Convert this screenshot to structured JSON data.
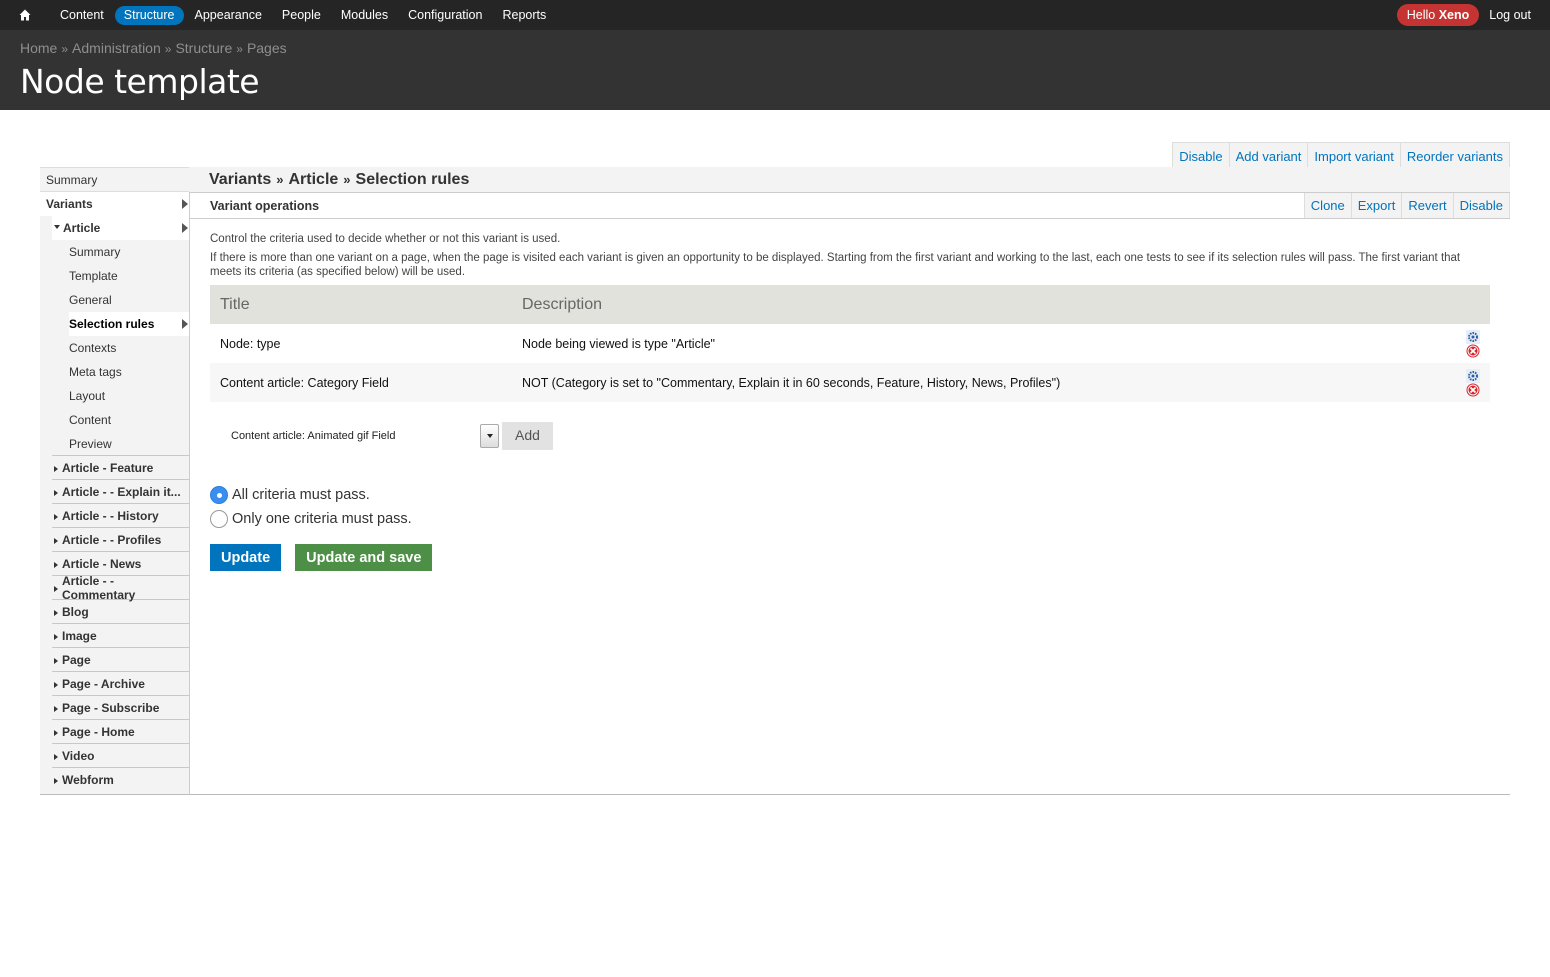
{
  "toolbar": {
    "home_icon": "home-icon",
    "items": [
      {
        "label": "Content",
        "active": false
      },
      {
        "label": "Structure",
        "active": true
      },
      {
        "label": "Appearance",
        "active": false
      },
      {
        "label": "People",
        "active": false
      },
      {
        "label": "Modules",
        "active": false
      },
      {
        "label": "Configuration",
        "active": false
      },
      {
        "label": "Reports",
        "active": false
      }
    ],
    "hello_prefix": "Hello",
    "user_name": "Xeno",
    "logout": "Log out"
  },
  "header": {
    "breadcrumb": [
      "Home",
      "Administration",
      "Structure",
      "Pages"
    ],
    "breadcrumb_sep": "»",
    "title": "Node template"
  },
  "top_operations": [
    "Disable",
    "Add variant",
    "Import variant",
    "Reorder variants"
  ],
  "sidebar": {
    "summary": "Summary",
    "variants": "Variants",
    "article": "Article",
    "article_children": [
      "Summary",
      "Template",
      "General",
      "Selection rules",
      "Contexts",
      "Meta tags",
      "Layout",
      "Content",
      "Preview"
    ],
    "active_child": "Selection rules",
    "groups": [
      "Article - Feature",
      "Article - - Explain it...",
      "Article - - History",
      "Article - - Profiles",
      "Article - News",
      "Article - - Commentary",
      "Blog",
      "Image",
      "Page",
      "Page - Archive",
      "Page - Subscribe",
      "Page - Home",
      "Video",
      "Webform"
    ]
  },
  "content": {
    "crumbs": [
      "Variants",
      "Article",
      "Selection rules"
    ],
    "crumb_sep": "»",
    "operations_label": "Variant operations",
    "variant_ops": [
      "Clone",
      "Export",
      "Revert",
      "Disable"
    ],
    "desc1": "Control the criteria used to decide whether or not this variant is used.",
    "desc2": "If there is more than one variant on a page, when the page is visited each variant is given an opportunity to be displayed. Starting from the first variant and working to the last, each one tests to see if its selection rules will pass. The first variant that meets its criteria (as specified below) will be used.",
    "table": {
      "headers": [
        "Title",
        "Description",
        ""
      ],
      "rows": [
        {
          "title": "Node: type",
          "description": "Node being viewed is type \"Article\""
        },
        {
          "title": "Content article: Category Field",
          "description": "NOT (Category is set to \"Commentary, Explain it in 60 seconds, Feature, History, News, Profiles\")"
        }
      ]
    },
    "add_select_value": "Content article: Animated gif Field",
    "add_button": "Add",
    "radios": [
      {
        "label": "All criteria must pass.",
        "checked": true
      },
      {
        "label": "Only one criteria must pass.",
        "checked": false
      }
    ],
    "update_button": "Update",
    "update_save_button": "Update and save"
  },
  "colors": {
    "toolbar_bg": "#252525",
    "header_bg": "#333333",
    "active_nav": "#0074bd",
    "hello_badge": "#c53433",
    "link": "#0074bd",
    "update_btn": "#0074bd",
    "update_save_btn": "#4d8f46"
  }
}
